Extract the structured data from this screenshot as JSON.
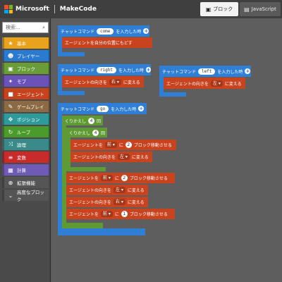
{
  "header": {
    "brand_ms": "Microsoft",
    "brand_app": "MakeCode",
    "tab_blocks": "ブロック",
    "tab_js": "JavaScript",
    "logo_colors": [
      "#f25022",
      "#7fba00",
      "#00a4ef",
      "#ffb900"
    ]
  },
  "sidebar": {
    "search_placeholder": "検索...",
    "items": [
      {
        "label": "基本",
        "icon": "star-icon",
        "color": "#e8a21b"
      },
      {
        "label": "プレイヤー",
        "icon": "person-icon",
        "color": "#2a7ad1"
      },
      {
        "label": "ブロック",
        "icon": "cube-icon",
        "color": "#6a9d38"
      },
      {
        "label": "モブ",
        "icon": "mob-icon",
        "color": "#6a52b8"
      },
      {
        "label": "エージェント",
        "icon": "agent-icon",
        "color": "#c6431e"
      },
      {
        "label": "ゲームプレイ",
        "icon": "wrench-icon",
        "color": "#8c6a43"
      },
      {
        "label": "ポジション",
        "icon": "position-icon",
        "color": "#2f9a9a"
      },
      {
        "label": "ループ",
        "icon": "loop-icon",
        "color": "#4b9a2c"
      },
      {
        "label": "論理",
        "icon": "shuffle-icon",
        "color": "#3a8a8a"
      },
      {
        "label": "変数",
        "icon": "list-icon",
        "color": "#c92a2a"
      },
      {
        "label": "計算",
        "icon": "calculator-icon",
        "color": "#6f5ab5"
      },
      {
        "label": "拡張機能",
        "icon": "plus-circle-icon",
        "color": "#555555"
      },
      {
        "label": "高度なブロック",
        "icon": "chevron-down-icon",
        "color": "#555555"
      }
    ]
  },
  "workspace": {
    "chat_label": "チャットコマンド",
    "chat_suffix": "を入力した時",
    "teleport": "エージェントを自分の位置にもどす",
    "turn_prefix": "エージェントの向きを",
    "turn_suffix": "に変える",
    "move_prefix": "エージェントを",
    "move_mid": "に",
    "move_suffix": "ブロック移動させる",
    "repeat_label": "くりかえし",
    "repeat_suffix": "回",
    "cmd_come": "come",
    "cmd_right": "right",
    "cmd_left": "left",
    "cmd_go": "go",
    "dir_right": "右",
    "dir_left": "左",
    "dir_forward": "前",
    "num_4a": "4",
    "num_4b": "4",
    "num_2a": "2",
    "num_2b": "2",
    "num_1": "1"
  }
}
